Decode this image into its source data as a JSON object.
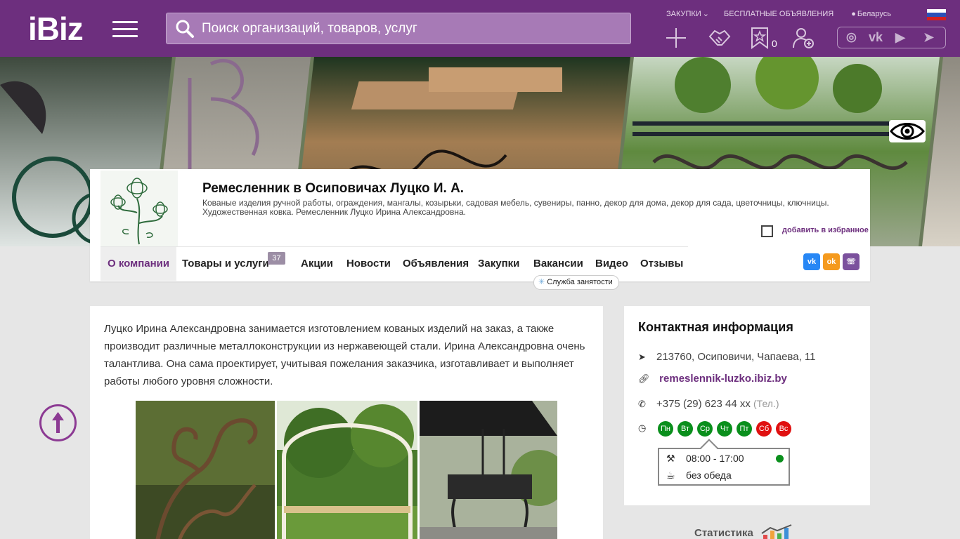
{
  "header": {
    "logo": "iBiz",
    "search_placeholder": "Поиск организаций, товаров, услуг",
    "links": [
      "ЗАКУПКИ",
      "БЕСПЛАТНЫЕ ОБЪЯВЛЕНИЯ",
      "Беларусь"
    ],
    "favorites_count": "0",
    "brand_color": "#6d2f7e"
  },
  "company": {
    "title": "Ремесленник в Осиповичах Луцко И. А.",
    "description": "Кованые изделия ручной работы, ограждения, мангалы, козырьки, садовая мебель, сувениры, панно, декор для дома, декор для сада, цветочницы, ключницы. Художественная ковка. Ремесленник Луцко Ирина Александровна.",
    "favorite_label": "добавить в избранное"
  },
  "tabs": [
    {
      "label": "О компании"
    },
    {
      "label": "Товары и услуги",
      "badge": "37"
    },
    {
      "label": "Акции"
    },
    {
      "label": "Новости"
    },
    {
      "label": "Объявления"
    },
    {
      "label": "Закупки"
    },
    {
      "label": "Вакансии"
    },
    {
      "label": "Видео"
    },
    {
      "label": "Отзывы"
    }
  ],
  "employment_tag": "Служба занятости",
  "about_text": "Луцко Ирина Александровна занимается изготовлением кованых изделий на заказ, а также производит различные металлоконструкции из нержавеющей стали. Ирина Александровна очень талантлива. Она сама проектирует, учитывая пожелания заказчика, изготавливает и выполняет работы любого уровня сложности.",
  "contact": {
    "title": "Контактная информация",
    "address": "213760, Осиповичи, Чапаева, 11",
    "website": "remeslennik-luzko.ibiz.by",
    "phone": "+375 (29) 623 44 xx",
    "phone_note": "(Тел.)",
    "days": [
      {
        "label": "Пн",
        "open": true
      },
      {
        "label": "Вт",
        "open": true
      },
      {
        "label": "Ср",
        "open": true
      },
      {
        "label": "Чт",
        "open": true
      },
      {
        "label": "Пт",
        "open": true
      },
      {
        "label": "Сб",
        "open": false
      },
      {
        "label": "Вс",
        "open": false
      }
    ],
    "hours": "08:00 - 17:00",
    "lunch": "без обеда"
  },
  "stats_label": "Статистика"
}
